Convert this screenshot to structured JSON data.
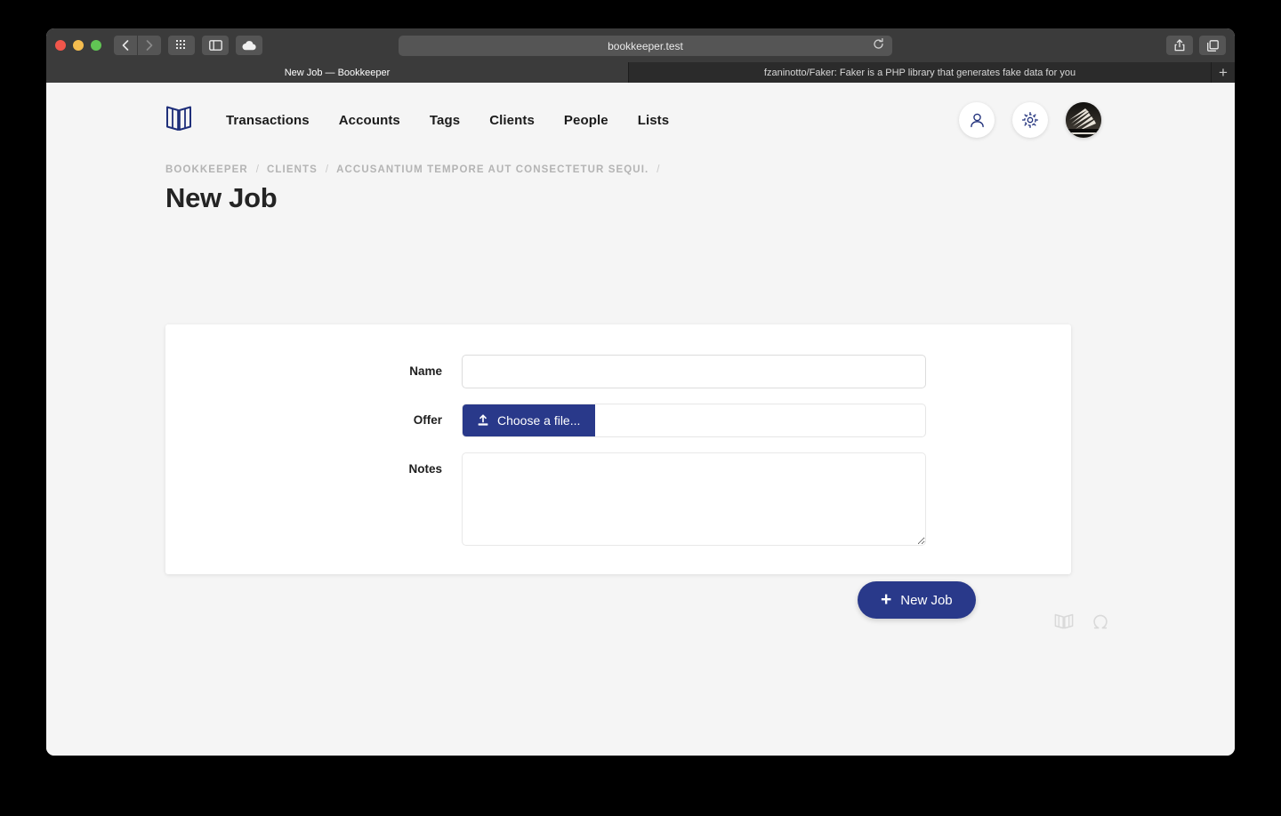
{
  "browser": {
    "address": "bookkeeper.test",
    "reload_icon": "reload-icon",
    "back_icon": "back-chevron-icon",
    "forward_icon": "forward-chevron-icon",
    "apps_icon": "grid-apps-icon",
    "sidebar_icon": "sidebar-toggle-icon",
    "cloud_icon": "icloud-icon",
    "share_icon": "share-icon",
    "tabs_overview_icon": "tabs-overview-icon",
    "new_tab_label": "+",
    "tabs": [
      {
        "title": "New Job — Bookkeeper",
        "active": true
      },
      {
        "title": "fzaninotto/Faker: Faker is a PHP library that generates fake data for you",
        "active": false
      }
    ]
  },
  "header": {
    "logo_name": "bookkeeper-logo",
    "nav": [
      {
        "label": "Transactions"
      },
      {
        "label": "Accounts"
      },
      {
        "label": "Tags"
      },
      {
        "label": "Clients"
      },
      {
        "label": "People"
      },
      {
        "label": "Lists"
      }
    ],
    "actions": {
      "profile_icon": "person-icon",
      "settings_icon": "gear-icon",
      "avatar": "user-avatar"
    }
  },
  "breadcrumb": {
    "items": [
      "BOOKKEEPER",
      "CLIENTS",
      "ACCUSANTIUM TEMPORE AUT CONSECTETUR SEQUI."
    ],
    "separator": "/"
  },
  "page": {
    "title": "New Job"
  },
  "form": {
    "fields": [
      {
        "label": "Name",
        "type": "text",
        "value": "",
        "placeholder": ""
      },
      {
        "label": "Offer",
        "type": "file",
        "value": "",
        "button_label": "Choose a file...",
        "button_icon": "upload-icon"
      },
      {
        "label": "Notes",
        "type": "textarea",
        "value": "",
        "placeholder": ""
      }
    ],
    "submit": {
      "label": "New Job",
      "icon": "plus-icon"
    }
  },
  "footer": {
    "icons": [
      {
        "name": "book-icon"
      },
      {
        "name": "omega-icon"
      }
    ]
  },
  "colors": {
    "brand_navy": "#29398a",
    "page_bg": "#f5f5f5",
    "card_bg": "#ffffff",
    "muted_text": "#b4b4b4",
    "heading_text": "#242424"
  }
}
